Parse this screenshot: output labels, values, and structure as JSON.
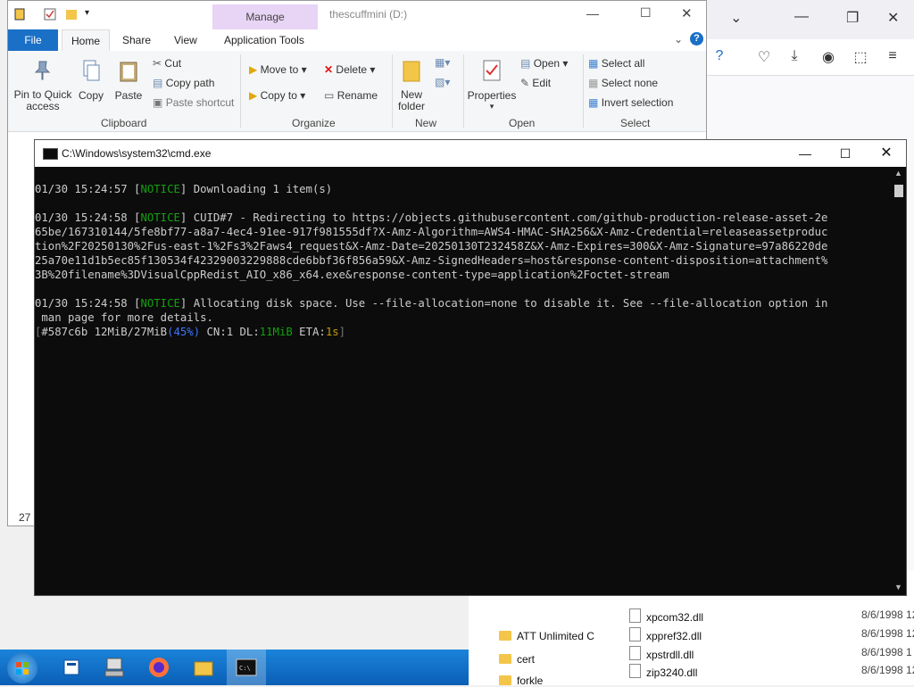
{
  "explorer": {
    "title": "thescuffmini (D:)",
    "manage_tab": "Manage",
    "tabs": [
      "File",
      "Home",
      "Share",
      "View",
      "Application Tools"
    ],
    "clipboard": {
      "pin": "Pin to Quick access",
      "copy": "Copy",
      "paste": "Paste",
      "cut": "Cut",
      "copy_path": "Copy path",
      "paste_shortcut": "Paste shortcut",
      "group": "Clipboard"
    },
    "organize": {
      "move_to": "Move to",
      "copy_to": "Copy to",
      "delete": "Delete",
      "rename": "Rename",
      "group": "Organize"
    },
    "new": {
      "new_folder": "New folder",
      "group": "New"
    },
    "open": {
      "properties": "Properties",
      "open": "Open",
      "edit": "Edit",
      "group": "Open"
    },
    "select": {
      "select_all": "Select all",
      "select_none": "Select none",
      "invert": "Invert selection",
      "group": "Select"
    },
    "status_count": "27"
  },
  "cmd": {
    "title": "C:\\Windows\\system32\\cmd.exe",
    "lines": {
      "l1_time": "01/30 15:24:57 [",
      "l1_tag": "NOTICE",
      "l1_rest": "] Downloading 1 item(s)",
      "l2_time": "01/30 15:24:58 [",
      "l2_tag": "NOTICE",
      "l2_rest": "] CUID#7 - Redirecting to https://objects.githubusercontent.com/github-production-release-asset-2e",
      "l3": "65be/167310144/5fe8bf77-a8a7-4ec4-91ee-917f981555df?X-Amz-Algorithm=AWS4-HMAC-SHA256&X-Amz-Credential=releaseassetproduc",
      "l4": "tion%2F20250130%2Fus-east-1%2Fs3%2Faws4_request&X-Amz-Date=20250130T232458Z&X-Amz-Expires=300&X-Amz-Signature=97a86220de",
      "l5": "25a70e11d1b5ec85f130534f42329003229888cde6bbf36f856a59&X-Amz-SignedHeaders=host&response-content-disposition=attachment%",
      "l6": "3B%20filename%3DVisualCppRedist_AIO_x86_x64.exe&response-content-type=application%2Foctet-stream",
      "l7_time": "01/30 15:24:58 [",
      "l7_tag": "NOTICE",
      "l7_rest": "] Allocating disk space. Use --file-allocation=none to disable it. See --file-allocation option in",
      "l8": " man page for more details.",
      "p_open": "[",
      "p_id": "#587c6b 12MiB/27MiB",
      "p_pct": "(45%)",
      "p_cn": " CN:1 DL:",
      "p_dl": "11MiB",
      "p_eta_l": " ETA:",
      "p_eta": "1s",
      "p_close": "]"
    }
  },
  "explorer2": {
    "folders": [
      "ATT Unlimited C",
      "cert",
      "forkle"
    ],
    "files": [
      {
        "name": "xpcom32.dll",
        "date": "8/6/1998 12"
      },
      {
        "name": "xppref32.dll",
        "date": "8/6/1998 12"
      },
      {
        "name": "xpstrdll.dll",
        "date": "8/6/1998 1"
      },
      {
        "name": "zip3240.dll",
        "date": "8/6/1998 12"
      }
    ]
  },
  "colors": {
    "file_tab": "#1a6fc6",
    "manage_tab": "#e8d4f5",
    "console_bg": "#0c0c0c",
    "notice_green": "#13a10e",
    "taskbar": "#0a5fb5"
  }
}
